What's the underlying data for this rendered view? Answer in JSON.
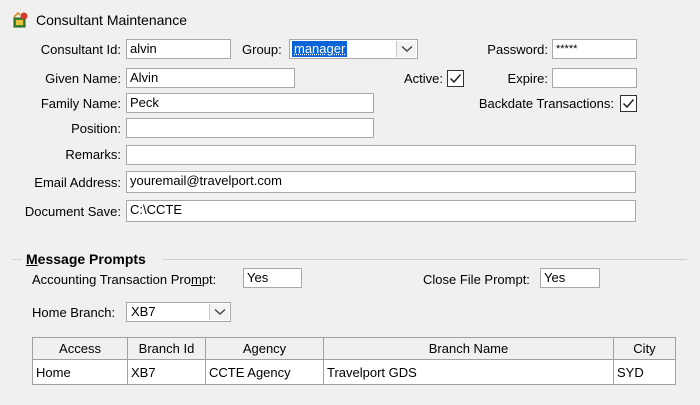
{
  "window": {
    "title": "Consultant Maintenance",
    "icon": "consultant-app-icon"
  },
  "form": {
    "consultant_id": {
      "label": "Consultant Id:",
      "value": "alvin"
    },
    "group": {
      "label": "Group:",
      "value": "manager"
    },
    "password": {
      "label": "Password:",
      "value": "*****"
    },
    "given_name": {
      "label": "Given Name:",
      "value": "Alvin"
    },
    "active": {
      "label": "Active:",
      "checked": true
    },
    "expire": {
      "label": "Expire:",
      "value": ""
    },
    "family_name": {
      "label": "Family Name:",
      "value": "Peck"
    },
    "backdate": {
      "label": "Backdate Transactions:",
      "checked": true
    },
    "position": {
      "label": "Position:",
      "value": ""
    },
    "remarks": {
      "label": "Remarks:",
      "value": ""
    },
    "email": {
      "label": "Email Address:",
      "value": "youremail@travelport.com"
    },
    "document_save": {
      "label": "Document Save:",
      "value": "C:\\CCTE"
    }
  },
  "message_prompts": {
    "title_first": "M",
    "title_rest": "essage Prompts",
    "accounting_label_a": "Accounting Transaction Pro",
    "accounting_label_u": "m",
    "accounting_label_b": "pt:",
    "accounting_value": "Yes",
    "close_file_label": "Close File Prompt:",
    "close_file_value": "Yes"
  },
  "home_branch": {
    "label": "Home Branch:",
    "value": "XB7"
  },
  "table": {
    "columns": [
      "Access",
      "Branch Id",
      "Agency",
      "Branch Name",
      "City"
    ],
    "rows": [
      {
        "access": "Home",
        "branch_id": "XB7",
        "agency": "CCTE Agency",
        "branch_name": "Travelport GDS",
        "city": "SYD"
      }
    ]
  }
}
